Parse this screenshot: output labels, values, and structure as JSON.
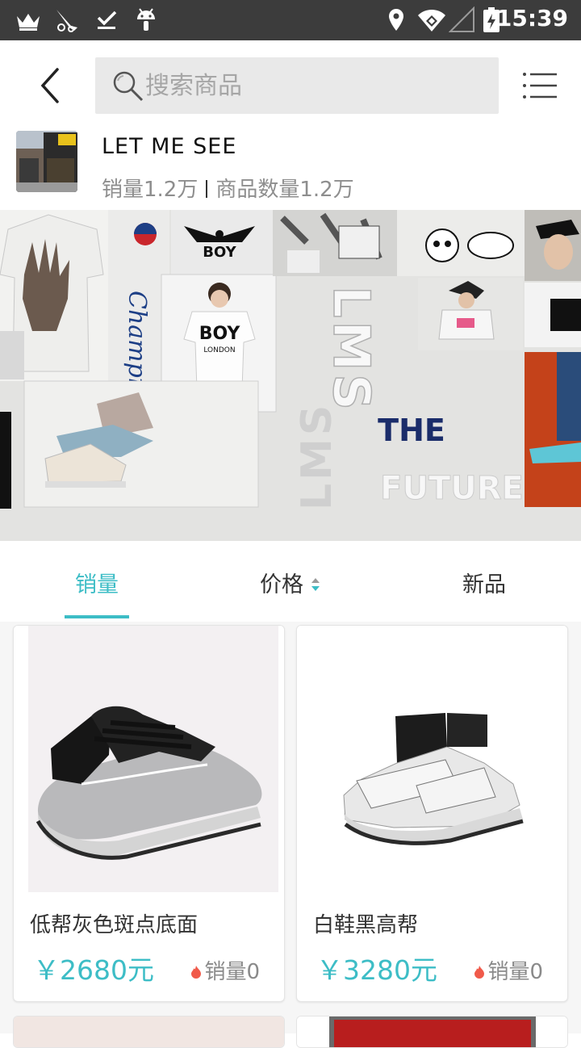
{
  "status_bar": {
    "time": "15:39",
    "left_icons": [
      "crown-icon",
      "bird-icon",
      "download-done-icon",
      "android-icon"
    ],
    "right_icons": [
      "location-icon",
      "wifi-icon",
      "signal-icon",
      "battery-charging-icon"
    ]
  },
  "header": {
    "search_placeholder": "搜索商品"
  },
  "shop": {
    "name": "LET  ME  SEE",
    "sales_label": "销量1.2万",
    "products_label": "商品数量1.2万"
  },
  "banner": {
    "texts": [
      "Champion",
      "BOY",
      "BOY",
      "LONDON",
      "LMS",
      "LMS",
      "THE",
      "FUTURE"
    ]
  },
  "sort_tabs": [
    {
      "label": "销量",
      "active": true
    },
    {
      "label": "价格",
      "active": false
    },
    {
      "label": "新品",
      "active": false
    }
  ],
  "products": [
    {
      "title": "低帮灰色斑点底面",
      "price": "￥2680元",
      "sales": "销量0"
    },
    {
      "title": "白鞋黑高帮",
      "price": "￥3280元",
      "sales": "销量0"
    }
  ],
  "colors": {
    "accent": "#3dbdc6",
    "status_bar": "#3c3c3c",
    "search_bg": "#e9e9e9",
    "fire": "#f05a4a"
  }
}
